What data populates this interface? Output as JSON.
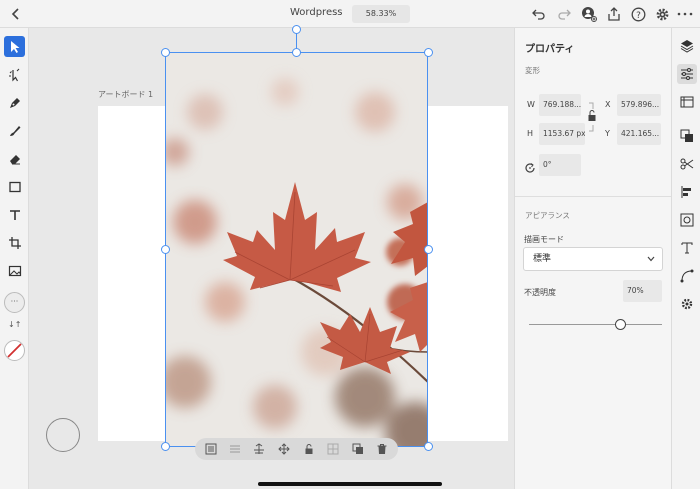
{
  "header": {
    "back_icon": "chevron-left-icon",
    "document_title": "Wordpress",
    "zoom": "58.33%",
    "right_icons": [
      "undo-icon",
      "redo-icon",
      "add-user-icon",
      "share-icon",
      "help-icon",
      "settings-icon"
    ]
  },
  "left_toolbar": {
    "tools": [
      "select-arrow-icon",
      "direct-select-icon",
      "pen-icon",
      "brush-icon",
      "eraser-icon",
      "rectangle-icon",
      "text-icon",
      "crop-icon",
      "image-icon"
    ],
    "more_label": "···",
    "swap_label": "↓↑"
  },
  "canvas": {
    "artboard_label": "アートボード 1",
    "context_icons": [
      "mask-icon",
      "align-icon",
      "stack-icon",
      "move-icon",
      "lock-icon",
      "grid-icon",
      "duplicate-icon",
      "trash-icon"
    ]
  },
  "properties": {
    "title": "プロパティ",
    "transform_section": "変形",
    "w_label": "W",
    "w_value": "769.188...",
    "x_label": "X",
    "x_value": "579.896...",
    "h_label": "H",
    "h_value": "1153.67 px",
    "y_label": "Y",
    "y_value": "421.165...",
    "rotation_value": "0°",
    "appearance_section": "アピアランス",
    "blend_mode_label": "描画モード",
    "blend_mode_value": "標準",
    "opacity_label": "不透明度",
    "opacity_value": "70%",
    "opacity_fraction": 0.7
  },
  "right_icons": [
    "layers-icon",
    "properties-icon",
    "libraries-icon",
    "assets-icon",
    "cut-icon",
    "align-left-icon",
    "target-icon",
    "type-icon",
    "path-icon",
    "plugins-icon"
  ],
  "colors": {
    "accent": "#2c6fdc",
    "selection": "#4a90f0",
    "stroke_none": "#d23030"
  }
}
